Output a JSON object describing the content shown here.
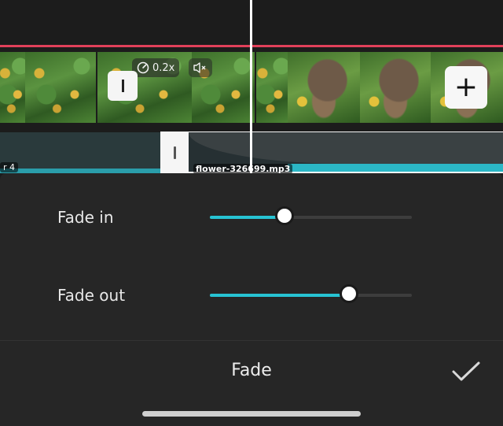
{
  "timeline": {
    "speed_label": "0.2x",
    "left_audio_label": "r 4",
    "audio_name": "flower-326699.mp3",
    "add_label": "+"
  },
  "fade_panel": {
    "fade_in": {
      "label": "Fade in",
      "value": 0.37
    },
    "fade_out": {
      "label": "Fade out",
      "value": 0.69
    },
    "title": "Fade"
  },
  "colors": {
    "accent": "#27c3d3",
    "timeline_marker": "#e2405a"
  },
  "icons": {
    "speed": "speed-dial-icon",
    "mute": "speaker-mute-icon",
    "confirm": "checkmark-icon",
    "add": "plus-icon"
  }
}
